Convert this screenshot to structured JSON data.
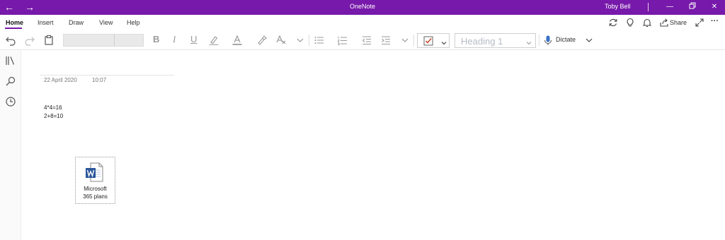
{
  "window": {
    "title": "OneNote",
    "user": "Toby Bell",
    "back_glyph": "←",
    "forward_glyph": "→",
    "minimize_glyph": "—",
    "close_glyph": "✕"
  },
  "ribbon": {
    "tabs": [
      {
        "label": "Home",
        "active": true
      },
      {
        "label": "Insert",
        "active": false
      },
      {
        "label": "Draw",
        "active": false
      },
      {
        "label": "View",
        "active": false
      },
      {
        "label": "Help",
        "active": false
      }
    ],
    "share_label": "Share",
    "more_glyph": "···"
  },
  "toolbar": {
    "bold_label": "B",
    "italic_label": "I",
    "underline_label": "U",
    "style_value": "Heading 1",
    "dictate_label": "Dictate"
  },
  "page": {
    "date": "22 April 2020",
    "time": "10:07",
    "lines": [
      "4*4=16",
      "2+8=10"
    ],
    "attachment": {
      "name_line1": "Microsoft",
      "name_line2": "365 plans",
      "icon": "word-document-icon"
    }
  },
  "colors": {
    "accent": "#7719aa",
    "word_blue": "#2b579a",
    "checkbox_red": "#c43e1c"
  }
}
